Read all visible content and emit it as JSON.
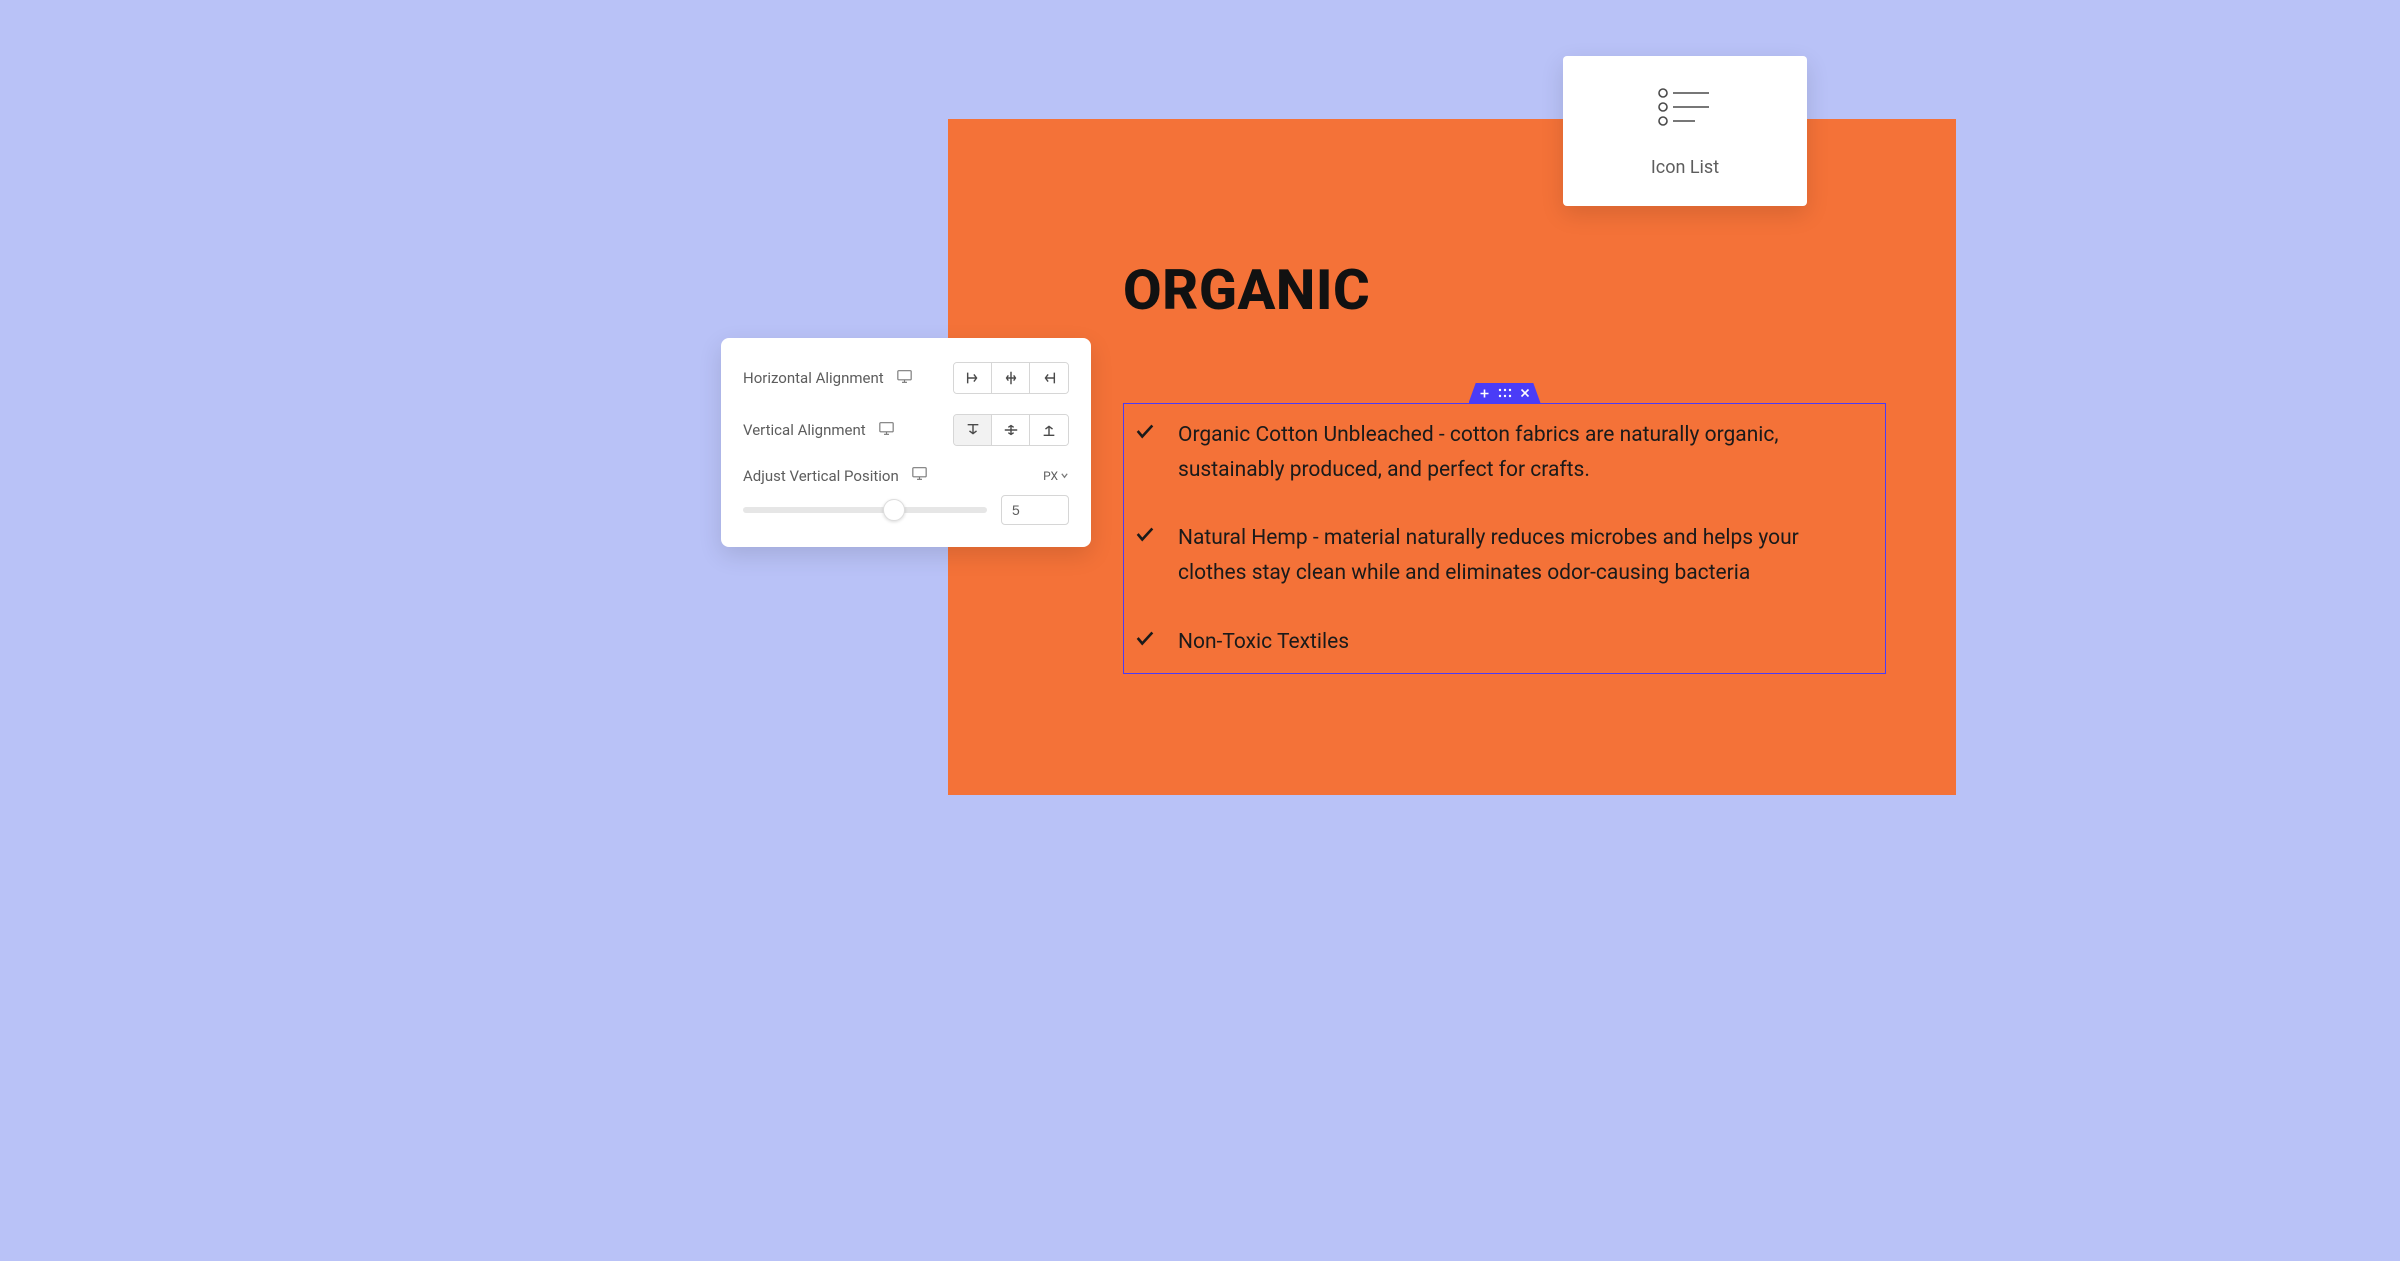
{
  "content": {
    "heading": "ORGANIC",
    "items": [
      "Organic Cotton Unbleached - cotton fabrics are naturally organic, sustainably produced, and perfect for crafts.",
      "Natural Hemp - material naturally reduces microbes and helps your clothes stay clean while and eliminates odor-causing bacteria",
      "Non-Toxic Textiles"
    ]
  },
  "controls": {
    "horizontal_label": "Horizontal Alignment",
    "vertical_label": "Vertical Alignment",
    "adjust_label": "Adjust Vertical Position",
    "unit": "PX",
    "slider_value": "5"
  },
  "widget_card": {
    "label": "Icon List"
  }
}
